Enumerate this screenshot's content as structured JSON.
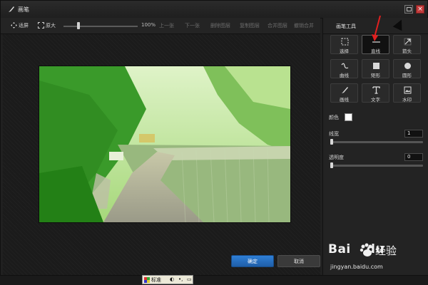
{
  "window": {
    "title": "画笔"
  },
  "toolbar": {
    "fit_screen": "适屏",
    "original_size": "原大",
    "zoom_value": "100%",
    "zoom_level": 1.0,
    "prev_image": "上一张",
    "next_image": "下一张",
    "delete_image": "删除图层",
    "copy_image": "复制图层",
    "merge_image": "合并图层",
    "undo_merge": "撤销合并"
  },
  "panel": {
    "title": "画笔工具",
    "tools": [
      {
        "label": "选择",
        "icon": "select-icon"
      },
      {
        "label": "直线",
        "icon": "line-icon",
        "selected": true
      },
      {
        "label": "箭头",
        "icon": "arrow-icon"
      },
      {
        "label": "曲线",
        "icon": "curve-icon"
      },
      {
        "label": "矩形",
        "icon": "rectangle-icon"
      },
      {
        "label": "圆形",
        "icon": "circle-icon"
      },
      {
        "label": "画线",
        "icon": "brush-icon"
      },
      {
        "label": "文字",
        "icon": "text-icon"
      },
      {
        "label": "水印",
        "icon": "watermark-icon"
      }
    ],
    "color_label": "颜色",
    "color_value": "#ffffff",
    "width_label": "线宽",
    "width_value": "1",
    "opacity_label": "透明度",
    "opacity_value": "0"
  },
  "buttons": {
    "ok": "确定",
    "cancel": "取消"
  },
  "watermark": {
    "brand": "Bai",
    "brand2": "du",
    "cn": "经验",
    "url": "jingyan.baidu.com"
  },
  "taskbar": {
    "label": "标准"
  }
}
